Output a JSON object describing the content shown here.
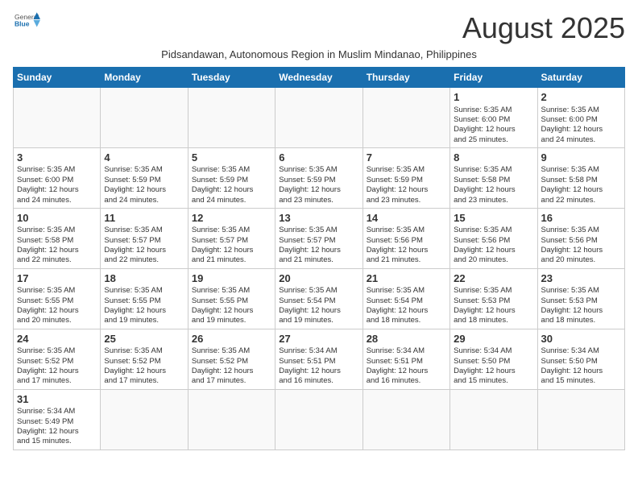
{
  "header": {
    "logo_text_normal": "General",
    "logo_text_blue": "Blue",
    "month_title": "August 2025",
    "subtitle": "Pidsandawan, Autonomous Region in Muslim Mindanao, Philippines"
  },
  "weekdays": [
    "Sunday",
    "Monday",
    "Tuesday",
    "Wednesday",
    "Thursday",
    "Friday",
    "Saturday"
  ],
  "weeks": [
    [
      {
        "day": "",
        "info": ""
      },
      {
        "day": "",
        "info": ""
      },
      {
        "day": "",
        "info": ""
      },
      {
        "day": "",
        "info": ""
      },
      {
        "day": "",
        "info": ""
      },
      {
        "day": "1",
        "info": "Sunrise: 5:35 AM\nSunset: 6:00 PM\nDaylight: 12 hours\nand 25 minutes."
      },
      {
        "day": "2",
        "info": "Sunrise: 5:35 AM\nSunset: 6:00 PM\nDaylight: 12 hours\nand 24 minutes."
      }
    ],
    [
      {
        "day": "3",
        "info": "Sunrise: 5:35 AM\nSunset: 6:00 PM\nDaylight: 12 hours\nand 24 minutes."
      },
      {
        "day": "4",
        "info": "Sunrise: 5:35 AM\nSunset: 5:59 PM\nDaylight: 12 hours\nand 24 minutes."
      },
      {
        "day": "5",
        "info": "Sunrise: 5:35 AM\nSunset: 5:59 PM\nDaylight: 12 hours\nand 24 minutes."
      },
      {
        "day": "6",
        "info": "Sunrise: 5:35 AM\nSunset: 5:59 PM\nDaylight: 12 hours\nand 23 minutes."
      },
      {
        "day": "7",
        "info": "Sunrise: 5:35 AM\nSunset: 5:59 PM\nDaylight: 12 hours\nand 23 minutes."
      },
      {
        "day": "8",
        "info": "Sunrise: 5:35 AM\nSunset: 5:58 PM\nDaylight: 12 hours\nand 23 minutes."
      },
      {
        "day": "9",
        "info": "Sunrise: 5:35 AM\nSunset: 5:58 PM\nDaylight: 12 hours\nand 22 minutes."
      }
    ],
    [
      {
        "day": "10",
        "info": "Sunrise: 5:35 AM\nSunset: 5:58 PM\nDaylight: 12 hours\nand 22 minutes."
      },
      {
        "day": "11",
        "info": "Sunrise: 5:35 AM\nSunset: 5:57 PM\nDaylight: 12 hours\nand 22 minutes."
      },
      {
        "day": "12",
        "info": "Sunrise: 5:35 AM\nSunset: 5:57 PM\nDaylight: 12 hours\nand 21 minutes."
      },
      {
        "day": "13",
        "info": "Sunrise: 5:35 AM\nSunset: 5:57 PM\nDaylight: 12 hours\nand 21 minutes."
      },
      {
        "day": "14",
        "info": "Sunrise: 5:35 AM\nSunset: 5:56 PM\nDaylight: 12 hours\nand 21 minutes."
      },
      {
        "day": "15",
        "info": "Sunrise: 5:35 AM\nSunset: 5:56 PM\nDaylight: 12 hours\nand 20 minutes."
      },
      {
        "day": "16",
        "info": "Sunrise: 5:35 AM\nSunset: 5:56 PM\nDaylight: 12 hours\nand 20 minutes."
      }
    ],
    [
      {
        "day": "17",
        "info": "Sunrise: 5:35 AM\nSunset: 5:55 PM\nDaylight: 12 hours\nand 20 minutes."
      },
      {
        "day": "18",
        "info": "Sunrise: 5:35 AM\nSunset: 5:55 PM\nDaylight: 12 hours\nand 19 minutes."
      },
      {
        "day": "19",
        "info": "Sunrise: 5:35 AM\nSunset: 5:55 PM\nDaylight: 12 hours\nand 19 minutes."
      },
      {
        "day": "20",
        "info": "Sunrise: 5:35 AM\nSunset: 5:54 PM\nDaylight: 12 hours\nand 19 minutes."
      },
      {
        "day": "21",
        "info": "Sunrise: 5:35 AM\nSunset: 5:54 PM\nDaylight: 12 hours\nand 18 minutes."
      },
      {
        "day": "22",
        "info": "Sunrise: 5:35 AM\nSunset: 5:53 PM\nDaylight: 12 hours\nand 18 minutes."
      },
      {
        "day": "23",
        "info": "Sunrise: 5:35 AM\nSunset: 5:53 PM\nDaylight: 12 hours\nand 18 minutes."
      }
    ],
    [
      {
        "day": "24",
        "info": "Sunrise: 5:35 AM\nSunset: 5:52 PM\nDaylight: 12 hours\nand 17 minutes."
      },
      {
        "day": "25",
        "info": "Sunrise: 5:35 AM\nSunset: 5:52 PM\nDaylight: 12 hours\nand 17 minutes."
      },
      {
        "day": "26",
        "info": "Sunrise: 5:35 AM\nSunset: 5:52 PM\nDaylight: 12 hours\nand 17 minutes."
      },
      {
        "day": "27",
        "info": "Sunrise: 5:34 AM\nSunset: 5:51 PM\nDaylight: 12 hours\nand 16 minutes."
      },
      {
        "day": "28",
        "info": "Sunrise: 5:34 AM\nSunset: 5:51 PM\nDaylight: 12 hours\nand 16 minutes."
      },
      {
        "day": "29",
        "info": "Sunrise: 5:34 AM\nSunset: 5:50 PM\nDaylight: 12 hours\nand 15 minutes."
      },
      {
        "day": "30",
        "info": "Sunrise: 5:34 AM\nSunset: 5:50 PM\nDaylight: 12 hours\nand 15 minutes."
      }
    ],
    [
      {
        "day": "31",
        "info": "Sunrise: 5:34 AM\nSunset: 5:49 PM\nDaylight: 12 hours\nand 15 minutes."
      },
      {
        "day": "",
        "info": ""
      },
      {
        "day": "",
        "info": ""
      },
      {
        "day": "",
        "info": ""
      },
      {
        "day": "",
        "info": ""
      },
      {
        "day": "",
        "info": ""
      },
      {
        "day": "",
        "info": ""
      }
    ]
  ]
}
